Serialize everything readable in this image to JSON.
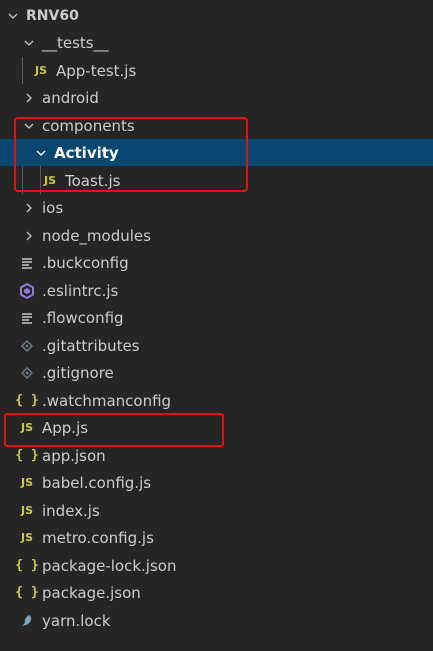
{
  "explorer": {
    "root": {
      "label": "RNV60"
    },
    "items": [
      {
        "label": "__tests__",
        "type": "folder",
        "expanded": true
      },
      {
        "label": "App-test.js",
        "icon": "js-file-icon",
        "icon_text": "JS"
      },
      {
        "label": "android",
        "type": "folder",
        "expanded": false
      },
      {
        "label": "components",
        "type": "folder",
        "expanded": true
      },
      {
        "label": "Activity",
        "type": "folder",
        "expanded": true,
        "selected": true
      },
      {
        "label": "Toast.js",
        "icon": "js-file-icon",
        "icon_text": "JS"
      },
      {
        "label": "ios",
        "type": "folder",
        "expanded": false
      },
      {
        "label": "node_modules",
        "type": "folder",
        "expanded": false
      },
      {
        "label": ".buckconfig",
        "icon": "text-lines-icon"
      },
      {
        "label": ".eslintrc.js",
        "icon": "eslint-icon"
      },
      {
        "label": ".flowconfig",
        "icon": "text-lines-icon"
      },
      {
        "label": ".gitattributes",
        "icon": "git-diamond-icon"
      },
      {
        "label": ".gitignore",
        "icon": "git-diamond-icon"
      },
      {
        "label": ".watchmanconfig",
        "icon": "json-braces-icon",
        "icon_text": "{ }"
      },
      {
        "label": "App.js",
        "icon": "js-file-icon",
        "icon_text": "JS"
      },
      {
        "label": "app.json",
        "icon": "json-braces-icon",
        "icon_text": "{ }"
      },
      {
        "label": "babel.config.js",
        "icon": "js-file-icon",
        "icon_text": "JS"
      },
      {
        "label": "index.js",
        "icon": "js-file-icon",
        "icon_text": "JS"
      },
      {
        "label": "metro.config.js",
        "icon": "js-file-icon",
        "icon_text": "JS"
      },
      {
        "label": "package-lock.json",
        "icon": "json-braces-icon",
        "icon_text": "{ }"
      },
      {
        "label": "package.json",
        "icon": "json-braces-icon",
        "icon_text": "{ }"
      },
      {
        "label": "yarn.lock",
        "icon": "yarn-icon"
      }
    ]
  },
  "colors": {
    "background": "#252526",
    "selected": "#094771",
    "js_icon": "#cbcb41",
    "eslint_icon": "#8f7ad6",
    "annotation": "#e01414"
  }
}
